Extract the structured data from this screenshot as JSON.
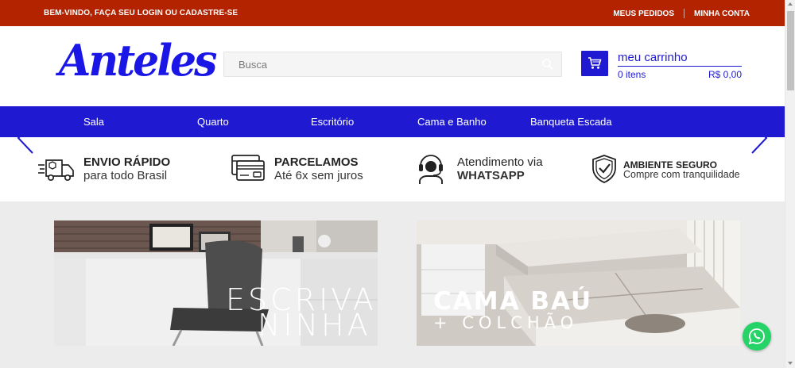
{
  "topbar": {
    "welcome": "BEM-VINDO, FAÇA SEU LOGIN OU CADASTRE-SE",
    "orders": "MEUS PEDIDOS",
    "account": "MINHA CONTA"
  },
  "header": {
    "logo_text": "Anteles",
    "search_placeholder": "Busca",
    "cart_title": "meu carrinho",
    "cart_items": "0 itens",
    "cart_total": "R$ 0,00"
  },
  "nav": {
    "items": [
      "Sala",
      "Quarto",
      "Escritório",
      "Cama e Banho",
      "Banqueta Escada"
    ]
  },
  "features": [
    {
      "icon": "delivery-truck-icon",
      "title": "ENVIO RÁPIDO",
      "subtitle": "para todo Brasil"
    },
    {
      "icon": "credit-card-icon",
      "title": "PARCELAMOS",
      "subtitle": "Até 6x sem juros"
    },
    {
      "icon": "headset-icon",
      "title": "Atendimento via",
      "subtitle": "WHATSAPP"
    },
    {
      "icon": "shield-check-icon",
      "title": "AMBIENTE SEGURO",
      "subtitle": "Compre com tranquilidade"
    }
  ],
  "banners": [
    {
      "line1": "ESCRIVA",
      "line2": "NINHA"
    },
    {
      "line1": "CAMA BAÚ",
      "line2": "+ COLCHÃO"
    }
  ],
  "colors": {
    "topbar": "#b32300",
    "brand_blue": "#1f1ad1",
    "logo_blue": "#1a16e6",
    "whatsapp": "#25d366"
  }
}
